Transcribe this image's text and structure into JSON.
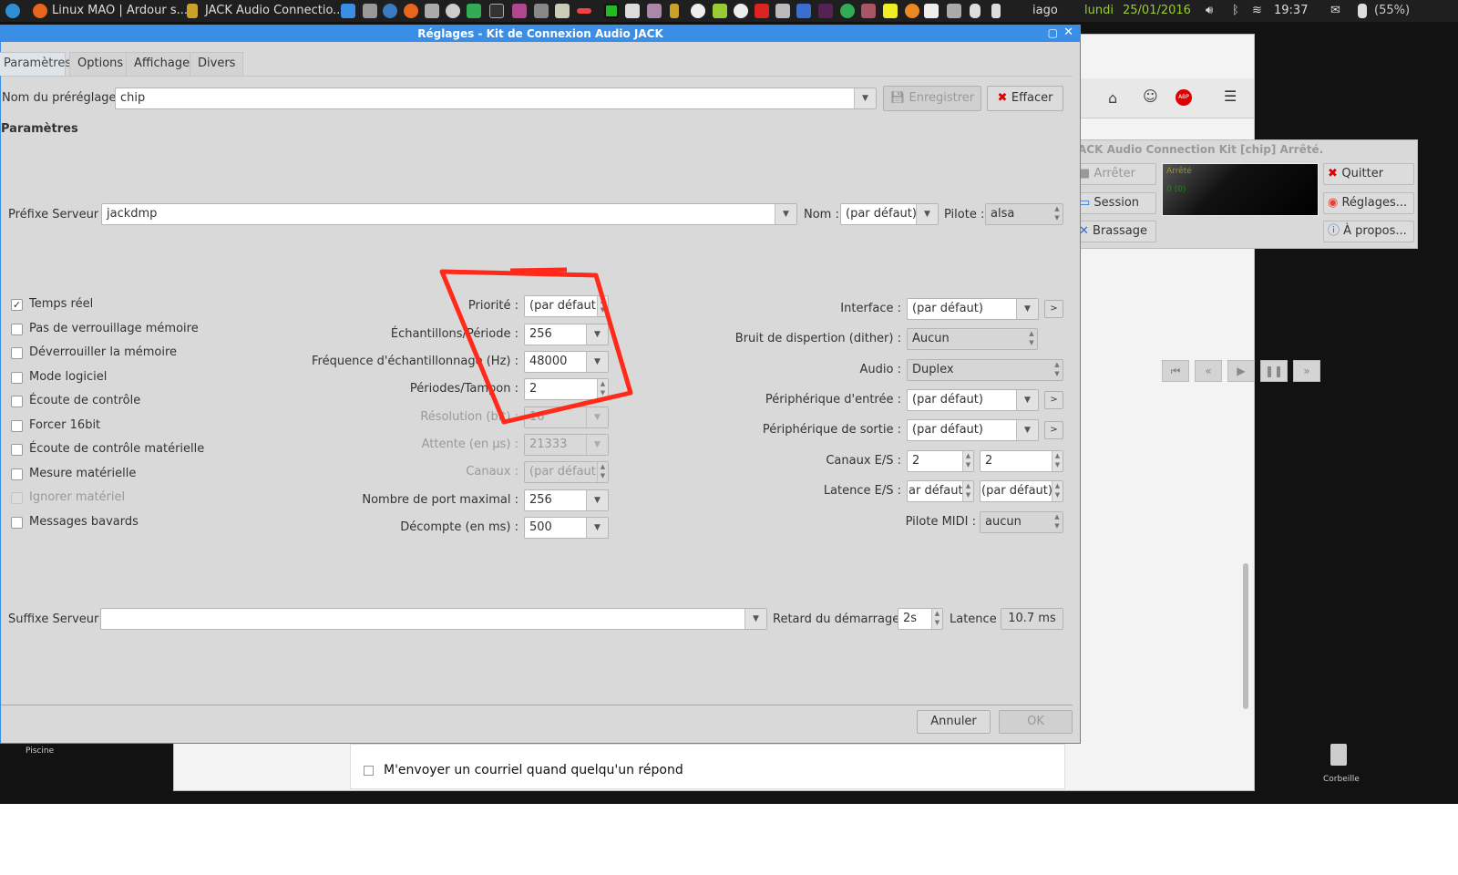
{
  "taskbar": {
    "task1": "Linux MAO | Ardour s...",
    "task2": "JACK Audio Connectio...",
    "user": "iago",
    "day": "lundi",
    "date": "25/01/2016",
    "time": "19:37",
    "battery": "(55%)"
  },
  "desktop": {
    "icon1": "Piscine",
    "icon2": "Corbeille"
  },
  "browser": {
    "notify_label": "M'envoyer un courriel quand quelqu'un répond"
  },
  "dialog": {
    "title": "Réglages - Kit de Connexion Audio JACK",
    "tabs": [
      "Paramètres",
      "Options",
      "Affichage",
      "Divers"
    ],
    "preset_label": "Nom du préréglage :",
    "preset_value": "chip",
    "save_label": "Enregistrer",
    "clear_label": "Effacer",
    "section_title": "Paramètres",
    "server_prefix_label": "Préfixe Serveur :",
    "server_prefix_value": "jackdmp",
    "name_label": "Nom :",
    "name_value": "(par défaut)",
    "driver_label": "Pilote :",
    "driver_value": "alsa",
    "checkboxes": [
      {
        "label": "Temps réel",
        "checked": true
      },
      {
        "label": "Pas de verrouillage mémoire",
        "checked": false
      },
      {
        "label": "Déverrouiller la mémoire",
        "checked": false
      },
      {
        "label": "Mode logiciel",
        "checked": false
      },
      {
        "label": "Écoute de contrôle",
        "checked": false
      },
      {
        "label": "Forcer 16bit",
        "checked": false
      },
      {
        "label": "Écoute de contrôle matérielle",
        "checked": false
      },
      {
        "label": "Mesure matérielle",
        "checked": false
      },
      {
        "label": "Ignorer matériel",
        "checked": false
      },
      {
        "label": "Messages bavards",
        "checked": false
      }
    ],
    "params": [
      {
        "label": "Priorité :",
        "value": "(par défaut)"
      },
      {
        "label": "Échantillons/Période :",
        "value": "256"
      },
      {
        "label": "Fréquence d'échantillonnage (Hz) :",
        "value": "48000"
      },
      {
        "label": "Périodes/Tampon :",
        "value": "2"
      },
      {
        "label": "Résolution (bit) :",
        "value": "16"
      },
      {
        "label": "Attente (en µs) :",
        "value": "21333"
      },
      {
        "label": "Canaux :",
        "value": "(par défaut)"
      },
      {
        "label": "Nombre de port maximal :",
        "value": "256"
      },
      {
        "label": "Décompte (en ms) :",
        "value": "500"
      }
    ],
    "right": [
      {
        "label": "Interface :",
        "value": "(par défaut)"
      },
      {
        "label": "Bruit de dispertion (dither) :",
        "value": "Aucun"
      },
      {
        "label": "Audio :",
        "value": "Duplex"
      },
      {
        "label": "Périphérique d'entrée :",
        "value": "(par défaut)"
      },
      {
        "label": "Périphérique de sortie :",
        "value": "(par défaut)"
      },
      {
        "label": "Canaux E/S :",
        "value": "2",
        "value2": "2"
      },
      {
        "label": "Latence E/S :",
        "value": "ar défaut)",
        "value2": "(par défaut)"
      },
      {
        "label": "Pilote MIDI :",
        "value": "aucun"
      }
    ],
    "more_label": ">",
    "suffix_label": "Suffixe Serveur :",
    "suffix_value": "",
    "delay_label": "Retard du démarrage :",
    "delay_value": "2s",
    "latency_label": "Latence :",
    "latency_value": "10.7 ms",
    "cancel_label": "Annuler",
    "ok_label": "OK"
  },
  "qjackctl": {
    "title": "ACK Audio Connection Kit [chip] Arrêté.",
    "stop": "Arrêter",
    "session": "Session",
    "patchbay": "Brassage",
    "quit": "Quitter",
    "setup": "Réglages...",
    "about": "À propos...",
    "status": "Arrêté",
    "xruns": "0 (0)"
  },
  "colors": {
    "accent": "#3a8ee6",
    "annotation": "#ff2a1a"
  }
}
